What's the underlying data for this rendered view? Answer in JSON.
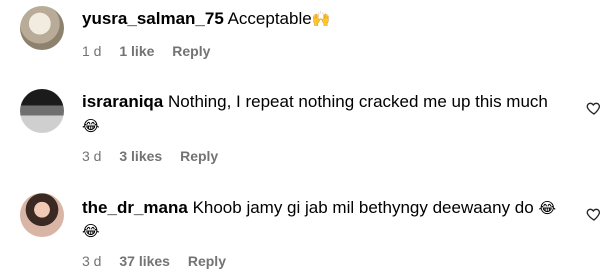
{
  "comments": [
    {
      "username": "yusra_salman_75",
      "text": "Acceptable",
      "emoji": "🙌",
      "time": "1 d",
      "likes": "1 like",
      "reply": "Reply",
      "avatar_icon": "avatar-photo"
    },
    {
      "username": "israraniqa",
      "text": "Nothing, I repeat nothing cracked me up this much",
      "emoji": "😂",
      "time": "3 d",
      "likes": "3 likes",
      "reply": "Reply",
      "avatar_icon": "avatar-photo"
    },
    {
      "username": "the_dr_mana",
      "text": "Khoob jamy gi jab mil bethyngy deewaany do",
      "emoji": "😂",
      "emoji2": "😂",
      "time": "3 d",
      "likes": "37 likes",
      "reply": "Reply",
      "avatar_icon": "avatar-photo"
    }
  ],
  "colors": {
    "meta": "#737373",
    "text": "#000000"
  },
  "icons": {
    "like": "heart-outline-icon"
  }
}
